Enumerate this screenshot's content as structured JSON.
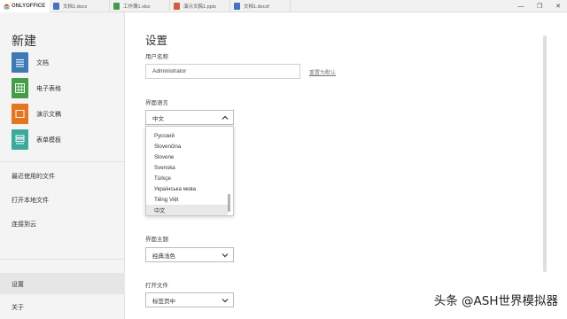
{
  "app": {
    "brand": "ONLYOFFICE"
  },
  "tabs": [
    {
      "label": "文档1.docx",
      "color": "#4472c4"
    },
    {
      "label": "工作簿1.xlsx",
      "color": "#41a045"
    },
    {
      "label": "演示文稿1.pptx",
      "color": "#d85c3a"
    },
    {
      "label": "文档1.docxf",
      "color": "#4472c4"
    }
  ],
  "window_controls": {
    "minimize": "—",
    "restore": "❐",
    "close": "✕"
  },
  "sidebar": {
    "new_title": "新建",
    "new_items": [
      {
        "label": "文档",
        "color": "#3d7ab8"
      },
      {
        "label": "电子表格",
        "color": "#41a045"
      },
      {
        "label": "演示文稿",
        "color": "#e8751d"
      },
      {
        "label": "表单模板",
        "color": "#3aaa9e"
      }
    ],
    "nav": [
      "最近使用的文件",
      "打开本地文件",
      "连接到云"
    ],
    "bottom": [
      "设置",
      "关于"
    ]
  },
  "main": {
    "title": "设置",
    "username_label": "用户名称",
    "username_value": "Administrator",
    "reset_link": "重置为默认",
    "language_label": "界面语言",
    "language_value": "中文",
    "language_options": [
      "Русский",
      "Slovenčina",
      "Slovene",
      "Svenska",
      "Türkçe",
      "Українська мова",
      "Tiếng Việt",
      "中文"
    ],
    "theme_label": "界面主题",
    "theme_value": "经典浅色",
    "open_label": "打开文件",
    "open_value": "标签页中"
  },
  "watermark": "头条 @ASH世界模拟器"
}
